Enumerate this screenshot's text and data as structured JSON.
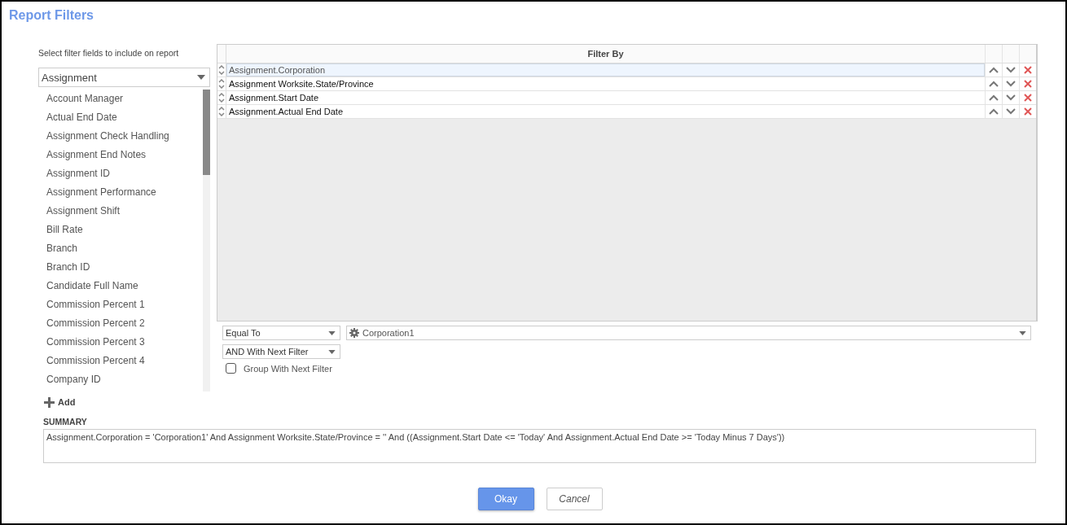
{
  "title": "Report Filters",
  "field_picker": {
    "label": "Select filter fields to include on report",
    "category": "Assignment",
    "items": [
      "Account Manager",
      "Actual End Date",
      "Assignment Check Handling",
      "Assignment End Notes",
      "Assignment ID",
      "Assignment Performance",
      "Assignment Shift",
      "Bill Rate",
      "Branch",
      "Branch ID",
      "Candidate Full Name",
      "Commission Percent 1",
      "Commission Percent 2",
      "Commission Percent 3",
      "Commission Percent 4",
      "Company ID"
    ],
    "add_label": "Add"
  },
  "filter_grid": {
    "header": "Filter By",
    "rows": [
      {
        "field": "Assignment.Corporation",
        "selected": true
      },
      {
        "field": "Assignment Worksite.State/Province",
        "selected": false
      },
      {
        "field": "Assignment.Start Date",
        "selected": false
      },
      {
        "field": "Assignment.Actual End Date",
        "selected": false
      }
    ]
  },
  "operator": "Equal To",
  "value": "Corporation1",
  "conjunction": "AND With Next Filter",
  "group_with_next": {
    "label": "Group With Next Filter",
    "checked": false
  },
  "summary": {
    "label": "SUMMARY",
    "text": "Assignment.Corporation = 'Corporation1' And Assignment Worksite.State/Province = '' And ((Assignment.Start Date <= 'Today' And Assignment.Actual End Date >= 'Today Minus 7 Days'))"
  },
  "buttons": {
    "ok": "Okay",
    "cancel": "Cancel"
  }
}
